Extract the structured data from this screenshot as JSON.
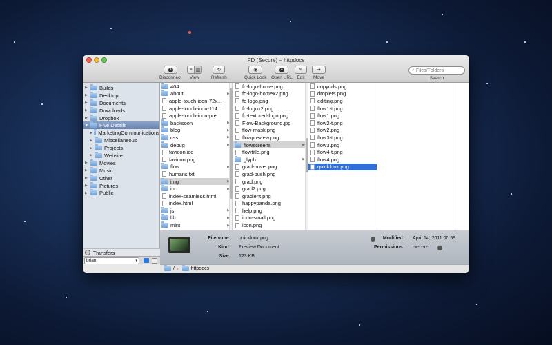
{
  "window": {
    "title": "FD (Secure) – httpdocs"
  },
  "toolbar": {
    "disconnect_label": "Disconnect",
    "view_label": "View",
    "refresh_label": "Refresh",
    "quicklook_label": "Quick Look",
    "openurl_label": "Open URL",
    "edit_label": "Edit",
    "move_label": "Move",
    "search_placeholder": "Files/Folders",
    "search_label": "Search"
  },
  "sidebar": {
    "items": [
      {
        "label": "Builds"
      },
      {
        "label": "Desktop"
      },
      {
        "label": "Documents"
      },
      {
        "label": "Downloads"
      },
      {
        "label": "Dropbox"
      },
      {
        "label": "Five Details"
      },
      {
        "label": "MarketingCommunications"
      },
      {
        "label": "Miscellaneous"
      },
      {
        "label": "Projects"
      },
      {
        "label": "Website"
      },
      {
        "label": "Movies"
      },
      {
        "label": "Music"
      },
      {
        "label": "Other"
      },
      {
        "label": "Pictures"
      },
      {
        "label": "Public"
      }
    ],
    "transfers_label": "Transfers",
    "user": "brian"
  },
  "columns": {
    "col1": [
      {
        "name": "404"
      },
      {
        "name": "about"
      },
      {
        "name": "apple-touch-icon-72x..."
      },
      {
        "name": "apple-touch-icon-114..."
      },
      {
        "name": "apple-touch-icon-pre..."
      },
      {
        "name": "backsoon"
      },
      {
        "name": "blog"
      },
      {
        "name": "css"
      },
      {
        "name": "debug"
      },
      {
        "name": "favicon.ico"
      },
      {
        "name": "favicon.png"
      },
      {
        "name": "flow"
      },
      {
        "name": "humans.txt"
      },
      {
        "name": "img"
      },
      {
        "name": "inc"
      },
      {
        "name": "index-seamless.html"
      },
      {
        "name": "index.html"
      },
      {
        "name": "js"
      },
      {
        "name": "lib"
      },
      {
        "name": "mint"
      }
    ],
    "col2": [
      {
        "name": "fd-logo-home.png"
      },
      {
        "name": "fd-logo-homex2.png"
      },
      {
        "name": "fd-logo.png"
      },
      {
        "name": "fd-logox2.png"
      },
      {
        "name": "fd-textured-logo.png"
      },
      {
        "name": "Flow-Background.jpg"
      },
      {
        "name": "flow-mask.png"
      },
      {
        "name": "flowpreview.png"
      },
      {
        "name": "flowscreens"
      },
      {
        "name": "flowtitle.png"
      },
      {
        "name": "glyph"
      },
      {
        "name": "grad-hover.png"
      },
      {
        "name": "grad-push.png"
      },
      {
        "name": "grad.png"
      },
      {
        "name": "grad2.png"
      },
      {
        "name": "gradient.png"
      },
      {
        "name": "happypanda.png"
      },
      {
        "name": "help.png"
      },
      {
        "name": "icon-small.png"
      },
      {
        "name": "icon.png"
      }
    ],
    "col3": [
      {
        "name": "copyurls.png"
      },
      {
        "name": "droplets.png"
      },
      {
        "name": "editing.png"
      },
      {
        "name": "flow1-t.png"
      },
      {
        "name": "flow1.png"
      },
      {
        "name": "flow2-t.png"
      },
      {
        "name": "flow2.png"
      },
      {
        "name": "flow3-t.png"
      },
      {
        "name": "flow3.png"
      },
      {
        "name": "flow4-t.png"
      },
      {
        "name": "flow4.png"
      },
      {
        "name": "quicklook.png"
      }
    ]
  },
  "info": {
    "filename_label": "Filename:",
    "filename": "quicklook.png",
    "kind_label": "Kind:",
    "kind": "Preview Document",
    "size_label": "Size:",
    "size": "123 KB",
    "modified_label": "Modified:",
    "modified": "April 14, 2011 00:59",
    "permissions_label": "Permissions:",
    "permissions": "rw-r--r--"
  },
  "pathbar": {
    "root": "/",
    "folder": "httpdocs"
  }
}
